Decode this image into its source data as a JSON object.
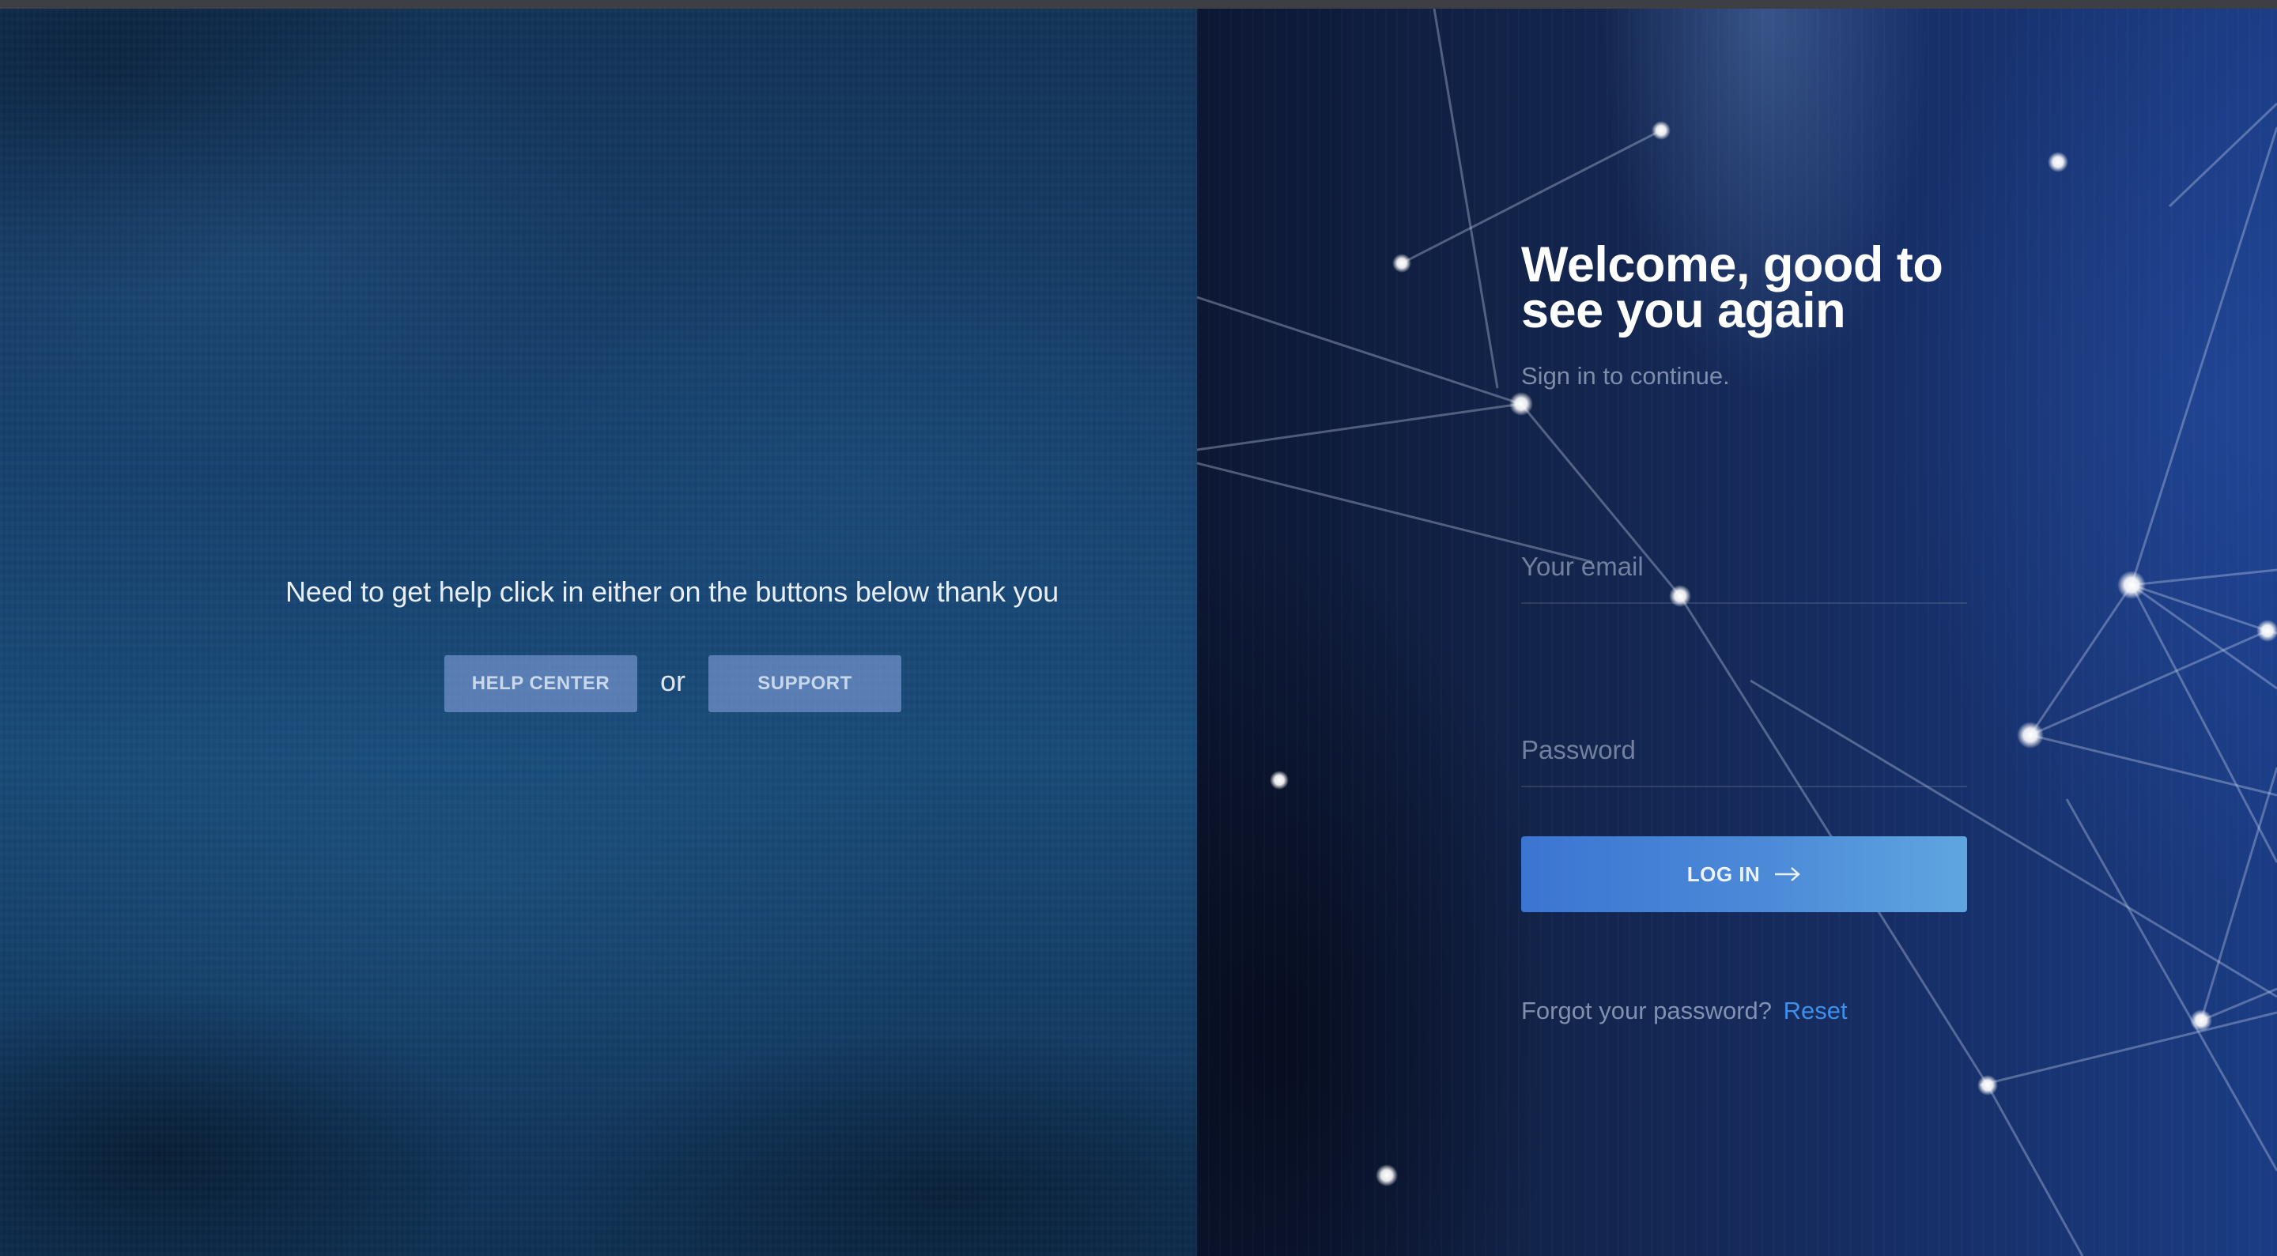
{
  "left": {
    "help_text": "Need to get help click in either on the buttons below thank you",
    "help_center_label": "HELP CENTER",
    "or_text": "or",
    "support_label": "SUPPORT"
  },
  "login": {
    "title_line1": "Welcome, good to",
    "title_line2": "see you again",
    "subtitle": "Sign in to continue.",
    "email_placeholder": "Your email",
    "email_value": "",
    "password_placeholder": "Password",
    "password_value": "",
    "login_label": "LOG IN",
    "login_icon": "arrow-right-icon",
    "forgot_text": "Forgot your password?",
    "reset_link": "Reset"
  },
  "colors": {
    "accent": "#3b75d2",
    "link": "#3f8fea",
    "ghost_button": "#8caae6"
  }
}
